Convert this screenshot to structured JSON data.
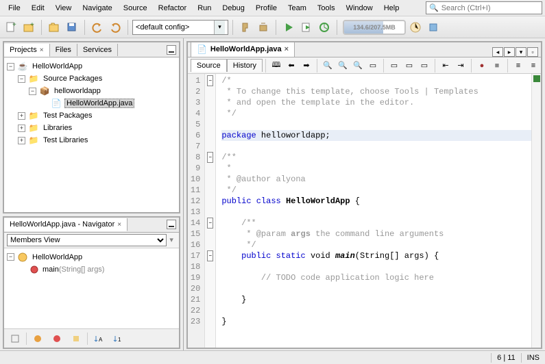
{
  "menu": [
    "File",
    "Edit",
    "View",
    "Navigate",
    "Source",
    "Refactor",
    "Run",
    "Debug",
    "Profile",
    "Team",
    "Tools",
    "Window",
    "Help"
  ],
  "search": {
    "placeholder": "Search (Ctrl+I)"
  },
  "config": {
    "value": "<default config>"
  },
  "memory": "134.6/207.5MB",
  "projects_pane": {
    "tabs": [
      "Projects",
      "Files",
      "Services"
    ],
    "active_tab": 0,
    "tree": {
      "root": "HelloWorldApp",
      "src_packages": "Source Packages",
      "package": "helloworldapp",
      "file": "HelloWorldApp.java",
      "test_packages": "Test Packages",
      "libraries": "Libraries",
      "test_libraries": "Test Libraries"
    }
  },
  "navigator": {
    "title": "HelloWorldApp.java - Navigator",
    "members_view": "Members View",
    "class": "HelloWorldApp",
    "method": "main",
    "method_sig": "(String[] args)"
  },
  "editor": {
    "tab": "HelloWorldApp.java",
    "subtabs": [
      "Source",
      "History"
    ],
    "active_subtab": 0,
    "lines": [
      {
        "n": 1,
        "fold": "minus",
        "cls": "comment",
        "text": "/*"
      },
      {
        "n": 2,
        "cls": "comment",
        "text": " * To change this template, choose Tools | Templates"
      },
      {
        "n": 3,
        "cls": "comment",
        "text": " * and open the template in the editor."
      },
      {
        "n": 4,
        "cls": "comment",
        "text": " */"
      },
      {
        "n": 5,
        "text": ""
      },
      {
        "n": 6,
        "hl": true,
        "html": "<span class='kw'>package</span> helloworldapp;"
      },
      {
        "n": 7,
        "text": ""
      },
      {
        "n": 8,
        "fold": "minus",
        "cls": "comment",
        "text": "/**"
      },
      {
        "n": 9,
        "cls": "comment",
        "text": " *"
      },
      {
        "n": 10,
        "cls": "comment",
        "text": " * @author alyona"
      },
      {
        "n": 11,
        "cls": "comment",
        "text": " */"
      },
      {
        "n": 12,
        "html": "<span class='kw'>public class</span> <span class='bold'>HelloWorldApp</span> {"
      },
      {
        "n": 13,
        "text": ""
      },
      {
        "n": 14,
        "fold": "minus",
        "cls": "comment",
        "text": "    /**"
      },
      {
        "n": 15,
        "cls": "comment",
        "html": "     * @param <span class='bold'>args</span> the command line arguments"
      },
      {
        "n": 16,
        "cls": "comment",
        "text": "     */"
      },
      {
        "n": 17,
        "fold": "minus",
        "html": "    <span class='kw'>public static</span> void <span class='bold' style='font-style:italic'>main</span>(String[] args) {"
      },
      {
        "n": 18,
        "text": ""
      },
      {
        "n": 19,
        "cls": "comment",
        "text": "        // TODO code application logic here"
      },
      {
        "n": 20,
        "text": ""
      },
      {
        "n": 21,
        "text": "    }"
      },
      {
        "n": 22,
        "text": ""
      },
      {
        "n": 23,
        "text": "}"
      }
    ]
  },
  "status": {
    "pos": "6 | 11",
    "mode": "INS"
  }
}
